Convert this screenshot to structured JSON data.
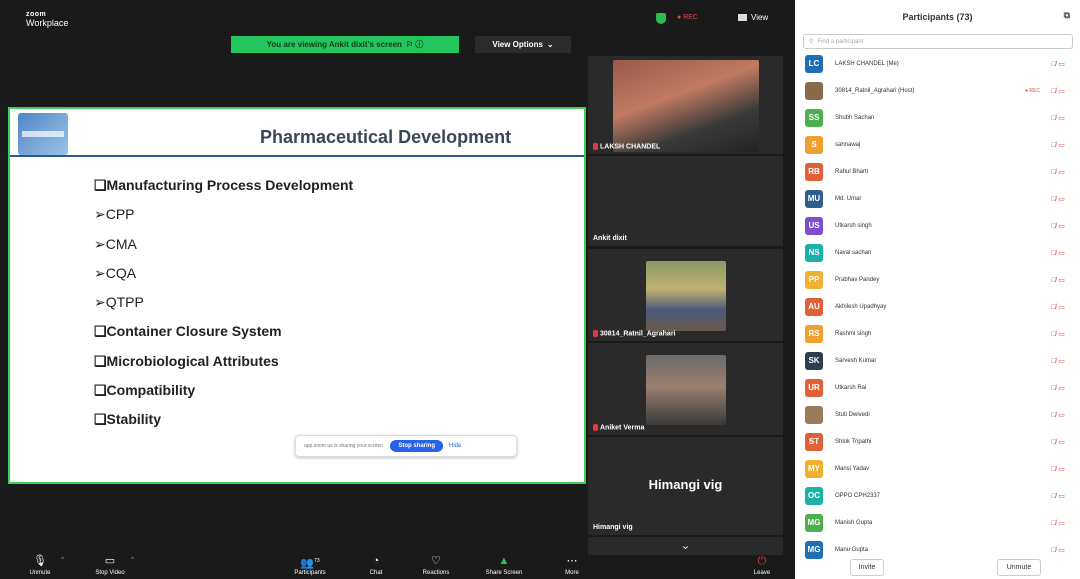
{
  "app": {
    "logo_top": "zoom",
    "logo_bottom": "Workplace",
    "rec": "● REC",
    "view": "View"
  },
  "banner": {
    "viewing": "You are viewing Ankit dixit's screen",
    "view_options": "View Options"
  },
  "slide": {
    "title": "Pharmaceutical Development",
    "bullets": [
      "❑Manufacturing Process Development",
      "➢CPP",
      "➢CMA",
      "➢CQA",
      "➢QTPP",
      "❑Container Closure System",
      "❑Microbiological Attributes",
      "❑Compatibility",
      "❑Stability"
    ],
    "toast_text": "app.zoom.us is sharing your screen.",
    "stop_sharing": "Stop sharing",
    "hide": "Hide"
  },
  "videos": {
    "t1": "LAKSH CHANDEL",
    "t2": "Ankit dixit",
    "t3": "30814_Ratnil_Agrahari",
    "t4": "Aniket Verma",
    "t5_big": "Himangi vig",
    "t5": "Himangi vig"
  },
  "toolbar": {
    "unmute": "Unmute",
    "stop_video": "Stop Video",
    "participants": "Participants",
    "participants_count": "73",
    "chat": "Chat",
    "reactions": "Reactions",
    "share_screen": "Share Screen",
    "more": "More",
    "leave": "Leave"
  },
  "panel": {
    "title": "Participants (73)",
    "search_placeholder": "Find a participant",
    "invite": "Invite",
    "unmute": "Unmute",
    "participants": [
      {
        "initials": "LC",
        "name": "LAKSH CHANDEL (Me)",
        "color": "#1f6fb5"
      },
      {
        "initials": "",
        "name": "30814_Ratnil_Agrahari (Host)",
        "color": "#8a6a4a",
        "rec": "● REC"
      },
      {
        "initials": "SS",
        "name": "Shubh Sachan",
        "color": "#4caf50"
      },
      {
        "initials": "S",
        "name": "sahnawaj",
        "color": "#f0a030"
      },
      {
        "initials": "RB",
        "name": "Rahul Bharti",
        "color": "#e0603a"
      },
      {
        "initials": "MU",
        "name": "Md. Umar",
        "color": "#2f5f8f"
      },
      {
        "initials": "US",
        "name": "Utkarsh singh",
        "color": "#7b4fd0"
      },
      {
        "initials": "NS",
        "name": "Naval sachan",
        "color": "#1cb0a8"
      },
      {
        "initials": "PP",
        "name": "Prabhav Pandey",
        "color": "#f0b030"
      },
      {
        "initials": "AU",
        "name": "Akhilesh Upadhyay",
        "color": "#e0603a"
      },
      {
        "initials": "RS",
        "name": "Rashmi singh",
        "color": "#f0a030"
      },
      {
        "initials": "SK",
        "name": "Sarvesh Kumar",
        "color": "#2c3e50"
      },
      {
        "initials": "UR",
        "name": "Utkarsh Rai",
        "color": "#e0603a"
      },
      {
        "initials": "",
        "name": "Stuti Dwivedi",
        "color": "#9a7a5a"
      },
      {
        "initials": "ST",
        "name": "Shlok Tripathi",
        "color": "#e0603a"
      },
      {
        "initials": "MY",
        "name": "Mansi Yadav",
        "color": "#f0b030"
      },
      {
        "initials": "OC",
        "name": "OPPO CPH2337",
        "color": "#1cb0a8"
      },
      {
        "initials": "MG",
        "name": "Manish Gupta",
        "color": "#4caf50"
      },
      {
        "initials": "MG",
        "name": "Manu Gupta",
        "color": "#1f6fb5"
      }
    ]
  }
}
